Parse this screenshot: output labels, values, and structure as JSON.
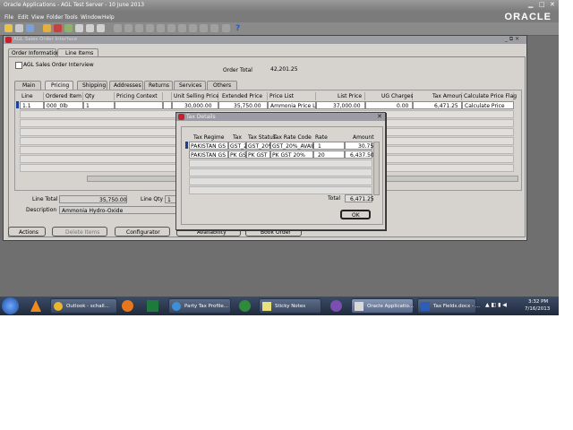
{
  "titlebar": {
    "title": "Oracle Applications - AGL Test Server - 10 June 2013"
  },
  "menu": {
    "items": [
      "File",
      "Edit",
      "View",
      "Folder",
      "Tools",
      "Window",
      "Help"
    ]
  },
  "brand": {
    "logo": "ORACLE"
  },
  "form": {
    "window_title": "AGL Sales Order Interface",
    "top_tabs": [
      "Order Information",
      "Line Items"
    ],
    "subtitle": "AGL Sales Order Interview",
    "order_total_label": "Order Total",
    "order_total_value": "42,201.25",
    "sub_tabs": [
      "Main",
      "Pricing",
      "Shipping",
      "Addresses",
      "Returns",
      "Services",
      "Others"
    ],
    "columns": [
      "Line",
      "Ordered Item",
      "Qty",
      "Pricing Context",
      "",
      "Unit Selling Price",
      "Extended Price",
      "Price List",
      "List Price",
      "UG Charges",
      "Tax Amount",
      "Calculate Price Flag"
    ],
    "row1": [
      "1.1",
      "000_0lb",
      "1",
      "",
      "",
      "30,000.00",
      "35,750.00",
      "Ammonia Price Lis",
      "37,000.00",
      "0.00",
      "6,471.25",
      "Calculate Price"
    ],
    "line_total_label": "Line Total",
    "line_total_value": "35,750.00",
    "line_qty_label": "Line Qty",
    "line_qty_value": "1",
    "description_label": "Description",
    "description_value": "Ammonia Hydro-Oxide",
    "buttons": [
      "Actions",
      "Delete Items",
      "Configurator",
      "Availability",
      "Book Order"
    ]
  },
  "dialog": {
    "title": "Tax Details",
    "columns": [
      "Tax Regime",
      "Tax",
      "Tax Status",
      "Tax Rate Code",
      "Rate",
      "Amount"
    ],
    "rows": [
      [
        "PAKISTAN GS",
        "GST_20",
        "GST_20%",
        "GST_20%_AVAIL",
        "1",
        "30.75"
      ],
      [
        "PAKISTAN GS",
        "PK GST",
        "PK GST",
        "PK GST 20%",
        "20",
        "6,437.50"
      ]
    ],
    "total_label": "Total",
    "total_value": "6,471.25",
    "ok_label": "OK"
  },
  "taskbar": {
    "tasks": [
      "Outlook - schall...",
      "Party Tax Profile...",
      "Sticky Notes",
      "Oracle Applicatio...",
      "Tax Fields.docx - ..."
    ],
    "time": "3:32 PM",
    "date": "7/16/2013"
  }
}
